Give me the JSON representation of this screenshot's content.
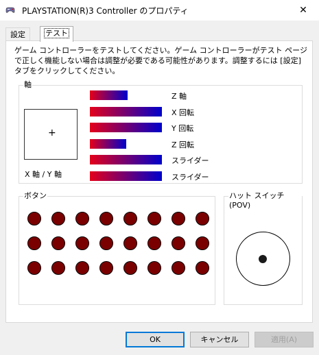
{
  "window": {
    "title": "PLAYSTATION(R)3 Controller のプロパティ",
    "close_glyph": "✕"
  },
  "tabs": [
    {
      "label": "設定",
      "selected": false
    },
    {
      "label": "テスト",
      "selected": true
    }
  ],
  "description": "ゲーム コントローラーをテストしてください。ゲーム コントローラーがテスト ページで正しく機能しない場合は調整が必要である可能性があります。調整するには [設定] タブをクリックしてください。",
  "axes_group": {
    "label": "軸",
    "xy_label": "X 軸 / Y 軸",
    "crosshair": "+",
    "bars": [
      {
        "label": "Z 軸",
        "level": 0.52
      },
      {
        "label": "X 回転",
        "level": 1.0
      },
      {
        "label": "Y 回転",
        "level": 1.0
      },
      {
        "label": "Z 回転",
        "level": 0.5
      },
      {
        "label": "スライダー",
        "level": 1.0
      },
      {
        "label": "スライダー",
        "level": 1.0
      }
    ],
    "bar_colors": {
      "start": "#e4001a",
      "end": "#0000cc"
    }
  },
  "buttons_group": {
    "label": "ボタン",
    "button_numbers": [
      "1",
      "2",
      "3",
      "4",
      "5",
      "6",
      "7",
      "8",
      "9",
      "10",
      "11",
      "12",
      "13",
      "14",
      "15",
      "16",
      "17",
      "18",
      "19",
      "20",
      "21",
      "22",
      "23",
      "24"
    ],
    "button_color": "#7a0000"
  },
  "pov_group": {
    "label": "ハット スイッチ (POV)"
  },
  "dialog_buttons": {
    "ok": "OK",
    "cancel": "キャンセル",
    "apply": "適用(A)"
  },
  "accent_color": "#0078d7"
}
